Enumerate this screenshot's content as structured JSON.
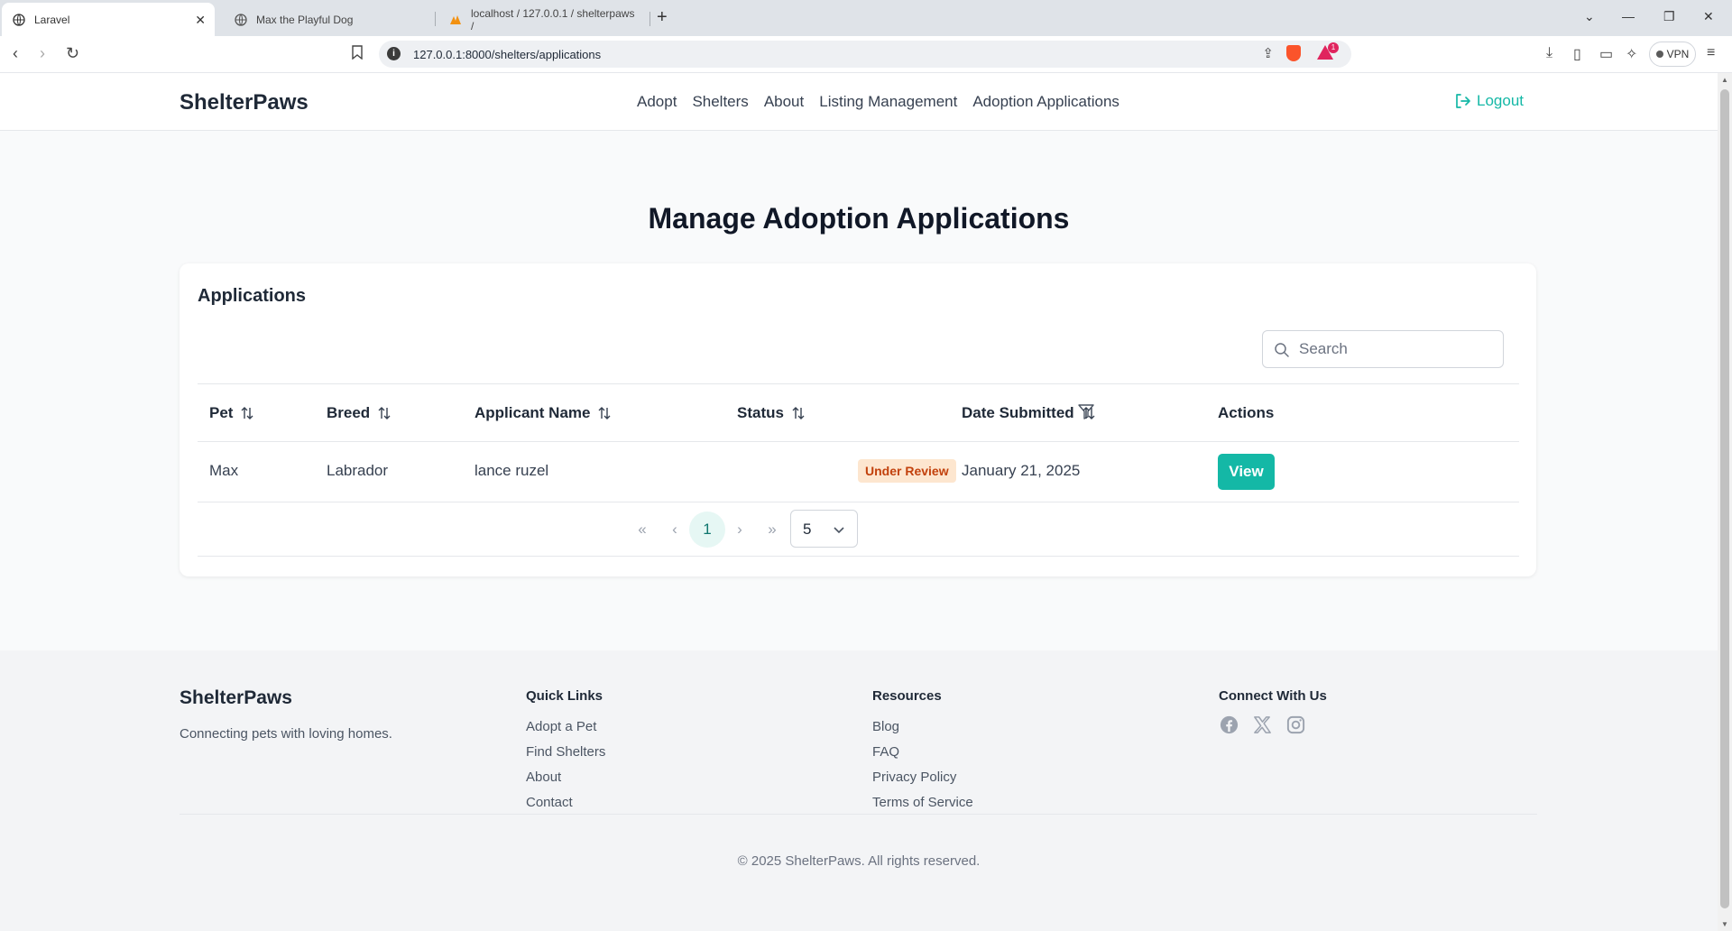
{
  "browser": {
    "tabs": [
      {
        "title": "Laravel",
        "active": true
      },
      {
        "title": "Max the Playful Dog",
        "active": false
      },
      {
        "title": "localhost / 127.0.0.1 / shelterpaws /",
        "active": false
      }
    ],
    "url": "127.0.0.1:8000/shelters/applications",
    "vpn_label": "VPN",
    "rewards_badge": "1"
  },
  "header": {
    "brand": "ShelterPaws",
    "nav": [
      "Adopt",
      "Shelters",
      "About",
      "Listing Management",
      "Adoption Applications"
    ],
    "logout_label": "Logout",
    "accent_color": "#14b8a6"
  },
  "page": {
    "title": "Manage Adoption Applications"
  },
  "applications": {
    "card_title": "Applications",
    "search_placeholder": "Search",
    "columns": [
      "Pet",
      "Breed",
      "Applicant Name",
      "Status",
      "Date Submitted",
      "Actions"
    ],
    "rows": [
      {
        "pet": "Max",
        "breed": "Labrador",
        "applicant": "lance ruzel",
        "status": "Under Review",
        "date": "January 21, 2025",
        "action": "View"
      }
    ],
    "pagination": {
      "current_page": "1",
      "rows_per_page": "5"
    }
  },
  "footer": {
    "brand": "ShelterPaws",
    "tagline": "Connecting pets with loving homes.",
    "quick_links": {
      "heading": "Quick Links",
      "items": [
        "Adopt a Pet",
        "Find Shelters",
        "About",
        "Contact"
      ]
    },
    "resources": {
      "heading": "Resources",
      "items": [
        "Blog",
        "FAQ",
        "Privacy Policy",
        "Terms of Service"
      ]
    },
    "connect": {
      "heading": "Connect With Us",
      "icons": [
        "facebook-icon",
        "x-twitter-icon",
        "instagram-icon"
      ]
    },
    "copyright": "© 2025 ShelterPaws. All rights reserved."
  }
}
